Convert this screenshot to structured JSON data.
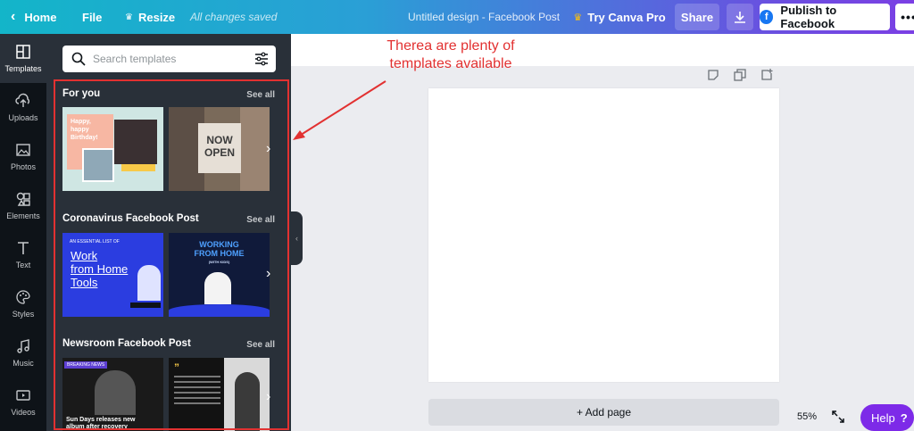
{
  "topbar": {
    "home": "Home",
    "file": "File",
    "resize": "Resize",
    "save_status": "All changes saved",
    "title": "Untitled design - Facebook Post",
    "try_pro": "Try Canva Pro",
    "share": "Share",
    "publish": "Publish to Facebook"
  },
  "rail": {
    "items": [
      {
        "label": "Templates",
        "icon": "templates-icon"
      },
      {
        "label": "Uploads",
        "icon": "upload-icon"
      },
      {
        "label": "Photos",
        "icon": "photo-icon"
      },
      {
        "label": "Elements",
        "icon": "shapes-icon"
      },
      {
        "label": "Text",
        "icon": "text-icon"
      },
      {
        "label": "Styles",
        "icon": "palette-icon"
      },
      {
        "label": "Music",
        "icon": "music-icon"
      },
      {
        "label": "Videos",
        "icon": "video-icon"
      }
    ]
  },
  "panel": {
    "search_placeholder": "Search templates",
    "see_all": "See all",
    "sections": [
      {
        "title": "For you",
        "thumbs": [
          {
            "texts": [
              "Happy,",
              "happy",
              "Birthday!"
            ]
          },
          {
            "texts": [
              "NOW",
              "OPEN"
            ]
          }
        ]
      },
      {
        "title": "Coronavirus Facebook Post",
        "thumbs": [
          {
            "texts": [
              "AN ESSENTIAL LIST OF",
              "Work",
              "from Home",
              "Tools"
            ]
          },
          {
            "texts": [
              "WORKING",
              "FROM HOME",
              "(WITH KIDS)"
            ]
          }
        ]
      },
      {
        "title": "Newsroom Facebook Post",
        "thumbs": [
          {
            "texts": [
              "BREAKING NEWS",
              "Sun Days releases new",
              "album after recovery"
            ]
          },
          {
            "texts": [
              "”"
            ]
          }
        ]
      }
    ]
  },
  "editor": {
    "add_page": "+ Add page",
    "zoom": "55%",
    "help": "Help",
    "help_mark": "?"
  },
  "annotation": {
    "line1": "Therea are plenty of",
    "line2": "templates available"
  }
}
